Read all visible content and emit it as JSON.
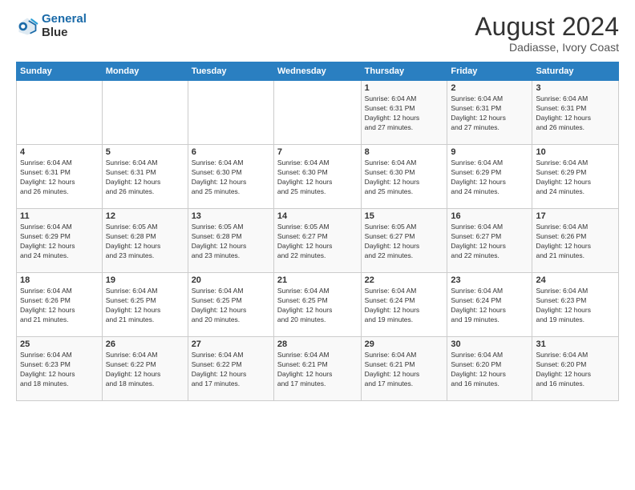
{
  "logo": {
    "line1": "General",
    "line2": "Blue"
  },
  "title": "August 2024",
  "subtitle": "Dadiasse, Ivory Coast",
  "days_of_week": [
    "Sunday",
    "Monday",
    "Tuesday",
    "Wednesday",
    "Thursday",
    "Friday",
    "Saturday"
  ],
  "weeks": [
    [
      {
        "day": "",
        "info": ""
      },
      {
        "day": "",
        "info": ""
      },
      {
        "day": "",
        "info": ""
      },
      {
        "day": "",
        "info": ""
      },
      {
        "day": "1",
        "info": "Sunrise: 6:04 AM\nSunset: 6:31 PM\nDaylight: 12 hours\nand 27 minutes."
      },
      {
        "day": "2",
        "info": "Sunrise: 6:04 AM\nSunset: 6:31 PM\nDaylight: 12 hours\nand 27 minutes."
      },
      {
        "day": "3",
        "info": "Sunrise: 6:04 AM\nSunset: 6:31 PM\nDaylight: 12 hours\nand 26 minutes."
      }
    ],
    [
      {
        "day": "4",
        "info": "Sunrise: 6:04 AM\nSunset: 6:31 PM\nDaylight: 12 hours\nand 26 minutes."
      },
      {
        "day": "5",
        "info": "Sunrise: 6:04 AM\nSunset: 6:31 PM\nDaylight: 12 hours\nand 26 minutes."
      },
      {
        "day": "6",
        "info": "Sunrise: 6:04 AM\nSunset: 6:30 PM\nDaylight: 12 hours\nand 25 minutes."
      },
      {
        "day": "7",
        "info": "Sunrise: 6:04 AM\nSunset: 6:30 PM\nDaylight: 12 hours\nand 25 minutes."
      },
      {
        "day": "8",
        "info": "Sunrise: 6:04 AM\nSunset: 6:30 PM\nDaylight: 12 hours\nand 25 minutes."
      },
      {
        "day": "9",
        "info": "Sunrise: 6:04 AM\nSunset: 6:29 PM\nDaylight: 12 hours\nand 24 minutes."
      },
      {
        "day": "10",
        "info": "Sunrise: 6:04 AM\nSunset: 6:29 PM\nDaylight: 12 hours\nand 24 minutes."
      }
    ],
    [
      {
        "day": "11",
        "info": "Sunrise: 6:04 AM\nSunset: 6:29 PM\nDaylight: 12 hours\nand 24 minutes."
      },
      {
        "day": "12",
        "info": "Sunrise: 6:05 AM\nSunset: 6:28 PM\nDaylight: 12 hours\nand 23 minutes."
      },
      {
        "day": "13",
        "info": "Sunrise: 6:05 AM\nSunset: 6:28 PM\nDaylight: 12 hours\nand 23 minutes."
      },
      {
        "day": "14",
        "info": "Sunrise: 6:05 AM\nSunset: 6:27 PM\nDaylight: 12 hours\nand 22 minutes."
      },
      {
        "day": "15",
        "info": "Sunrise: 6:05 AM\nSunset: 6:27 PM\nDaylight: 12 hours\nand 22 minutes."
      },
      {
        "day": "16",
        "info": "Sunrise: 6:04 AM\nSunset: 6:27 PM\nDaylight: 12 hours\nand 22 minutes."
      },
      {
        "day": "17",
        "info": "Sunrise: 6:04 AM\nSunset: 6:26 PM\nDaylight: 12 hours\nand 21 minutes."
      }
    ],
    [
      {
        "day": "18",
        "info": "Sunrise: 6:04 AM\nSunset: 6:26 PM\nDaylight: 12 hours\nand 21 minutes."
      },
      {
        "day": "19",
        "info": "Sunrise: 6:04 AM\nSunset: 6:25 PM\nDaylight: 12 hours\nand 21 minutes."
      },
      {
        "day": "20",
        "info": "Sunrise: 6:04 AM\nSunset: 6:25 PM\nDaylight: 12 hours\nand 20 minutes."
      },
      {
        "day": "21",
        "info": "Sunrise: 6:04 AM\nSunset: 6:25 PM\nDaylight: 12 hours\nand 20 minutes."
      },
      {
        "day": "22",
        "info": "Sunrise: 6:04 AM\nSunset: 6:24 PM\nDaylight: 12 hours\nand 19 minutes."
      },
      {
        "day": "23",
        "info": "Sunrise: 6:04 AM\nSunset: 6:24 PM\nDaylight: 12 hours\nand 19 minutes."
      },
      {
        "day": "24",
        "info": "Sunrise: 6:04 AM\nSunset: 6:23 PM\nDaylight: 12 hours\nand 19 minutes."
      }
    ],
    [
      {
        "day": "25",
        "info": "Sunrise: 6:04 AM\nSunset: 6:23 PM\nDaylight: 12 hours\nand 18 minutes."
      },
      {
        "day": "26",
        "info": "Sunrise: 6:04 AM\nSunset: 6:22 PM\nDaylight: 12 hours\nand 18 minutes."
      },
      {
        "day": "27",
        "info": "Sunrise: 6:04 AM\nSunset: 6:22 PM\nDaylight: 12 hours\nand 17 minutes."
      },
      {
        "day": "28",
        "info": "Sunrise: 6:04 AM\nSunset: 6:21 PM\nDaylight: 12 hours\nand 17 minutes."
      },
      {
        "day": "29",
        "info": "Sunrise: 6:04 AM\nSunset: 6:21 PM\nDaylight: 12 hours\nand 17 minutes."
      },
      {
        "day": "30",
        "info": "Sunrise: 6:04 AM\nSunset: 6:20 PM\nDaylight: 12 hours\nand 16 minutes."
      },
      {
        "day": "31",
        "info": "Sunrise: 6:04 AM\nSunset: 6:20 PM\nDaylight: 12 hours\nand 16 minutes."
      }
    ]
  ]
}
